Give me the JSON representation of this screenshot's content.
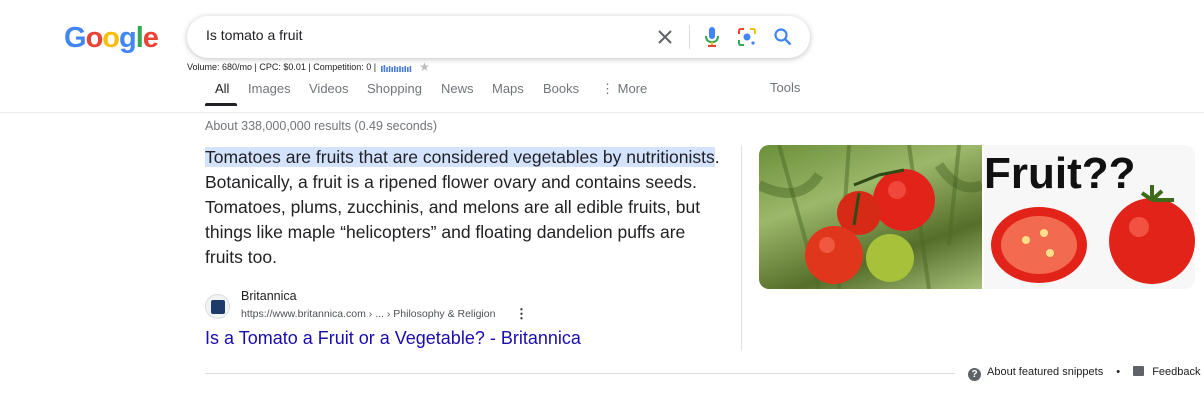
{
  "logo": {
    "letters": [
      "G",
      "o",
      "o",
      "g",
      "l",
      "e"
    ],
    "colors": [
      "#4285F4",
      "#EA4335",
      "#FBBC05",
      "#4285F4",
      "#34A853",
      "#EA4335"
    ]
  },
  "search": {
    "query": "Is tomato a fruit"
  },
  "keyword_stats": "Volume: 680/mo | CPC: $0.01 | Competition: 0 |",
  "tabs": [
    {
      "label": "All",
      "active": true
    },
    {
      "label": "Images"
    },
    {
      "label": "Videos"
    },
    {
      "label": "Shopping"
    },
    {
      "label": "News"
    },
    {
      "label": "Maps"
    },
    {
      "label": "Books"
    },
    {
      "label": "⋮ More"
    }
  ],
  "tools_label": "Tools",
  "result_stats": "About 338,000,000 results (0.49 seconds)",
  "snippet": {
    "highlight": "Tomatoes are fruits that are considered vegetables by nutritionists",
    "rest": ". Botanically, a fruit is a ripened flower ovary and contains seeds. Tomatoes, plums, zucchinis, and melons are all edible fruits, but things like maple “helicopters” and floating dandelion puffs are fruits too."
  },
  "source": {
    "name": "Britannica",
    "url": "https://www.britannica.com › ... › Philosophy & Religion",
    "more": "⋮"
  },
  "result_link": "Is a Tomato a Fruit or a Vegetable? - Britannica",
  "image_right_text": "Fruit??",
  "footer": {
    "about_label": "About featured snippets",
    "separator": "•",
    "feedback_label": "Feedback"
  },
  "colors": {
    "link": "#1a0dab",
    "highlight": "#d3e3fd",
    "tomato": "#e2231a"
  }
}
